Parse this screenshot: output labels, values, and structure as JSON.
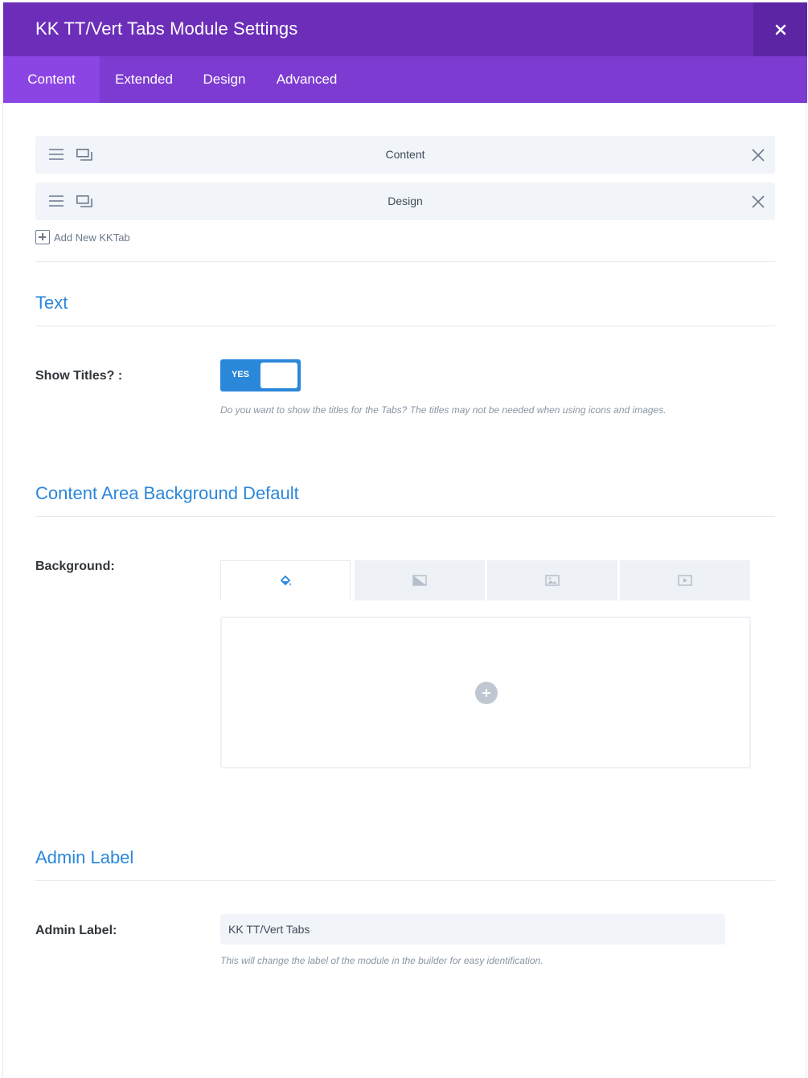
{
  "header": {
    "title": "KK TT/Vert Tabs Module Settings",
    "close_label": "×"
  },
  "tabs": [
    {
      "label": "Content",
      "active": true
    },
    {
      "label": "Extended",
      "active": false
    },
    {
      "label": "Design",
      "active": false
    },
    {
      "label": "Advanced",
      "active": false
    }
  ],
  "items": [
    {
      "label": "Content"
    },
    {
      "label": "Design"
    }
  ],
  "add_new_label": "Add New KKTab",
  "sections": {
    "text": {
      "title": "Text",
      "show_titles": {
        "label": "Show Titles? :",
        "toggle_value": "YES",
        "description": "Do you want to show the titles for the Tabs? The titles may not be needed when using icons and images."
      }
    },
    "background": {
      "title": "Content Area Background Default",
      "field_label": "Background:",
      "tab_icons": [
        "paint-bucket-icon",
        "gradient-icon",
        "image-icon",
        "video-icon"
      ]
    },
    "admin": {
      "title": "Admin Label",
      "field_label": "Admin Label:",
      "input_value": "KK TT/Vert Tabs",
      "description": "This will change the label of the module in the builder for easy identification."
    }
  },
  "colors": {
    "header_bg": "#6c2eb9",
    "tabs_bg": "#7d3bd1",
    "accent_blue": "#2b87da"
  }
}
